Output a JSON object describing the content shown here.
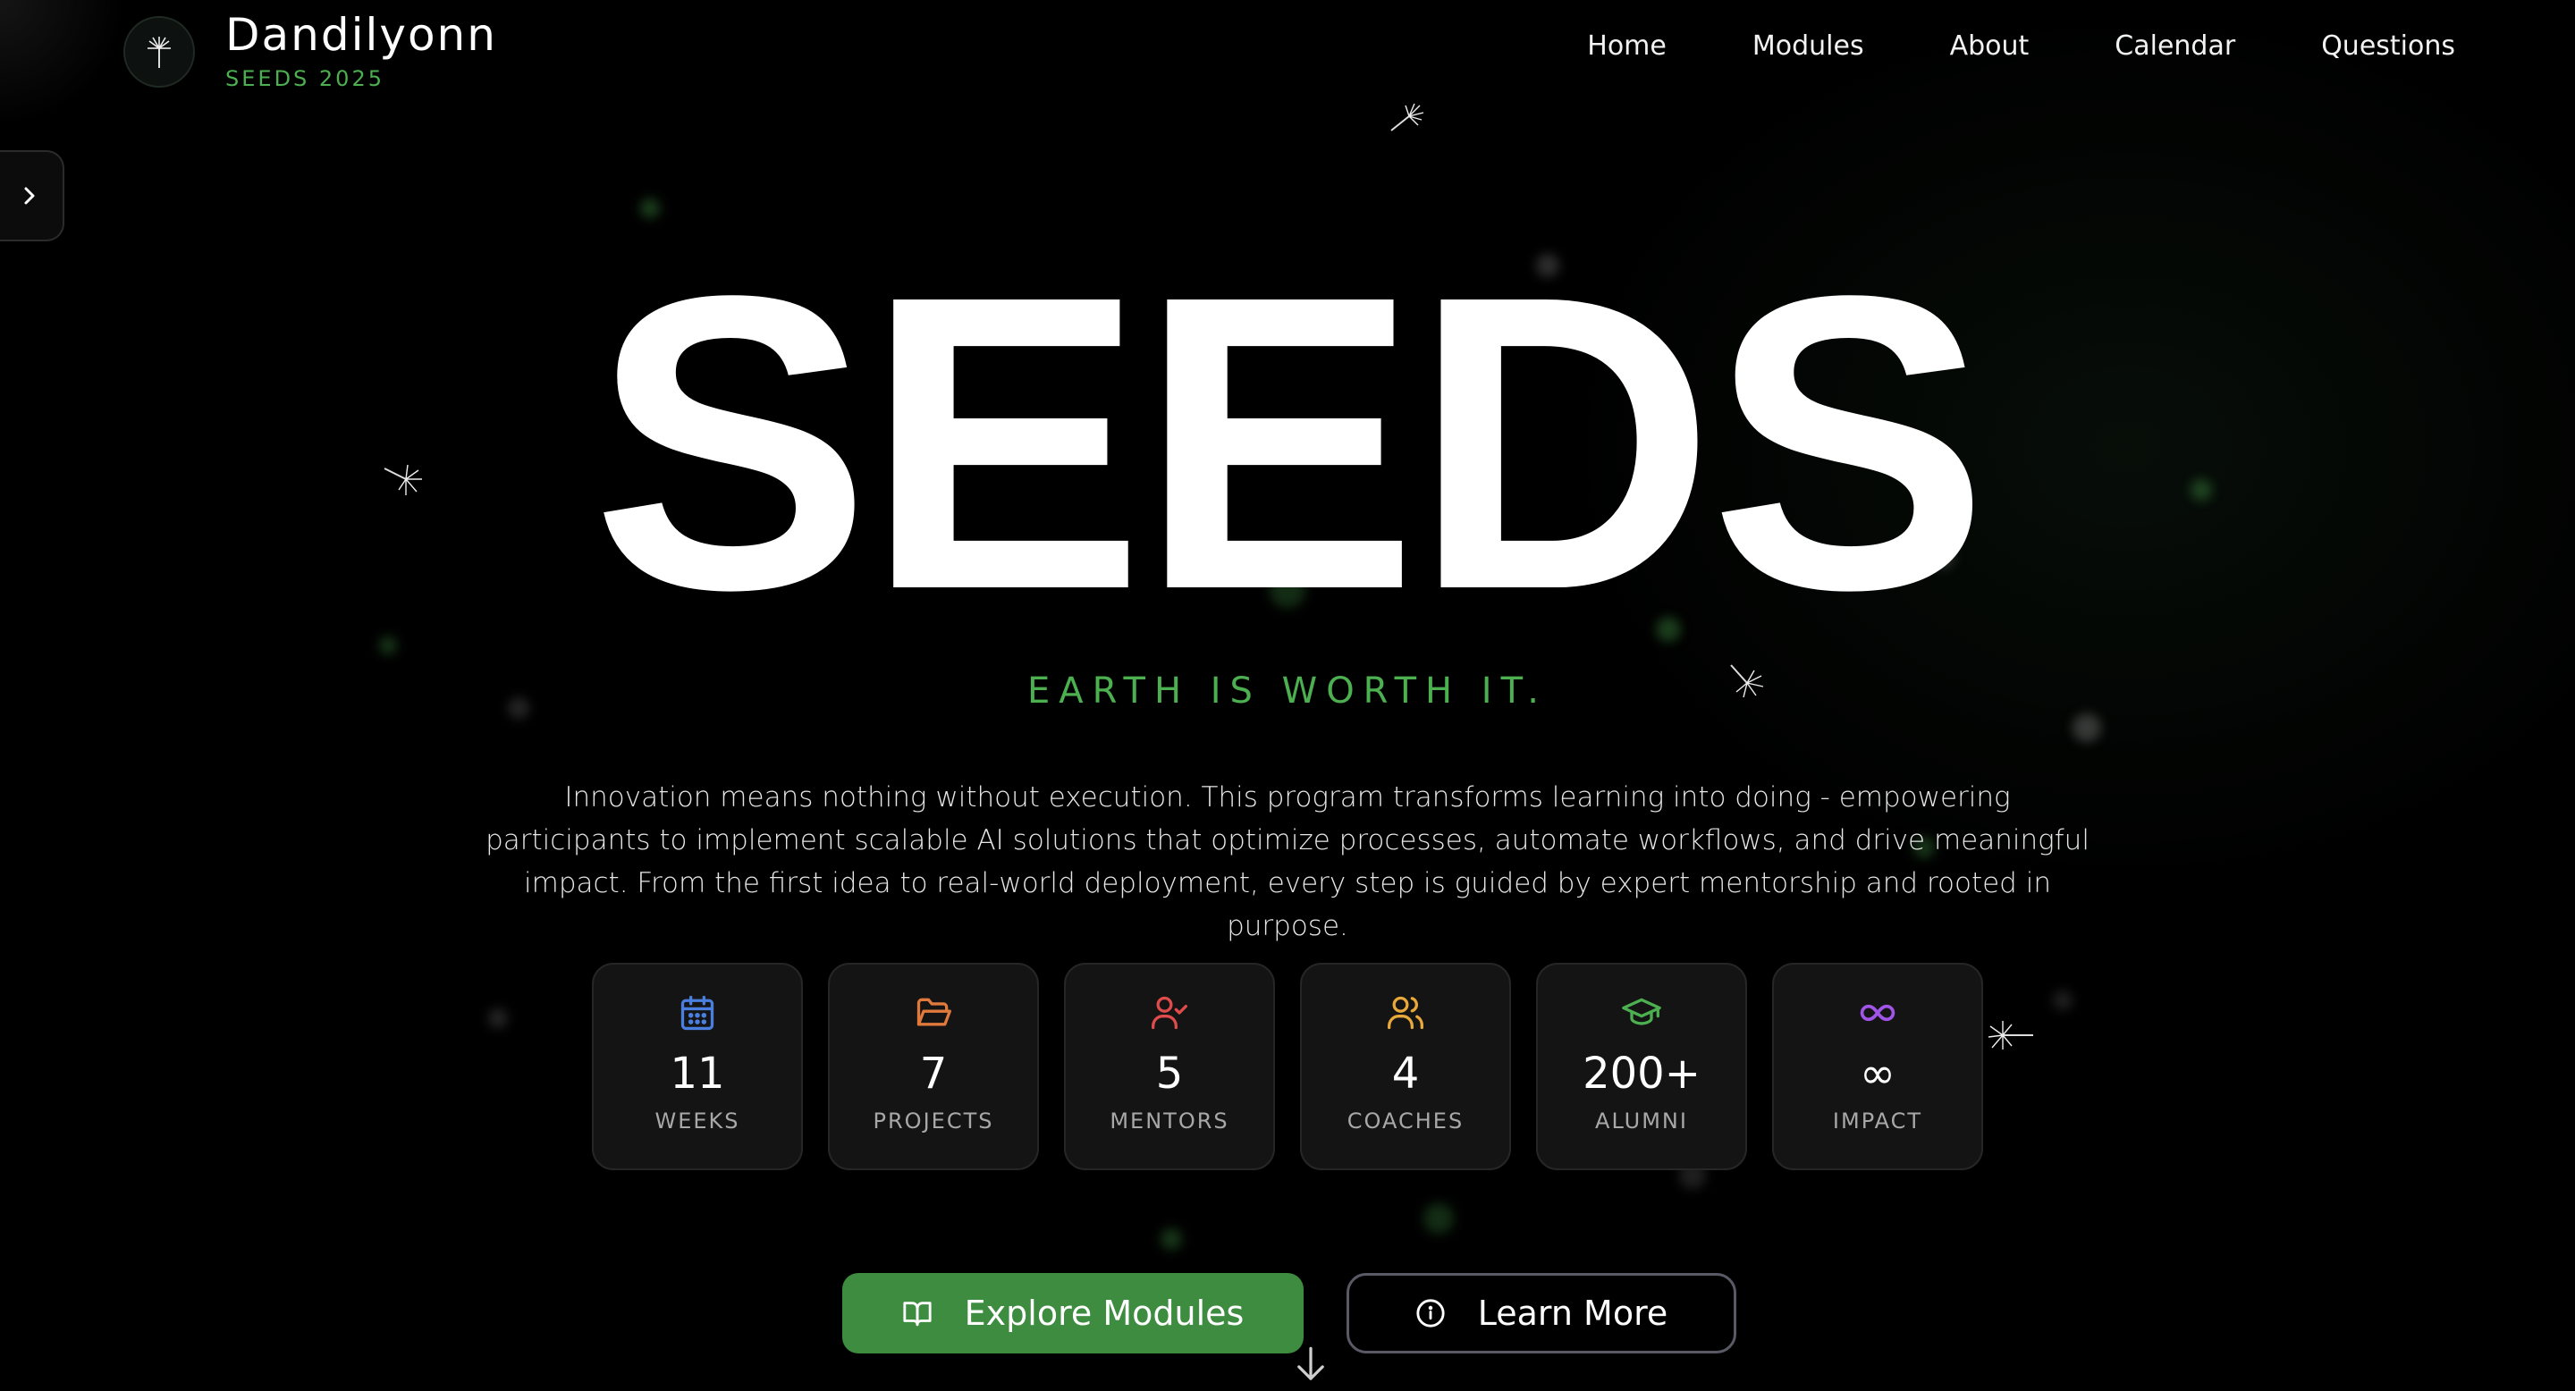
{
  "brand": {
    "name": "Dandilyonn",
    "subtitle": "SEEDS 2025",
    "logo_icon": "dandelion-icon"
  },
  "nav": {
    "items": [
      {
        "label": "Home"
      },
      {
        "label": "Modules"
      },
      {
        "label": "About"
      },
      {
        "label": "Calendar"
      },
      {
        "label": "Questions"
      }
    ]
  },
  "sidebar_toggle": {
    "icon": "chevron-right-icon"
  },
  "hero": {
    "title": "SEEDS",
    "tagline": "EARTH IS WORTH IT.",
    "intro": "Innovation means nothing without execution. This program transforms learning into doing - empowering participants to implement scalable AI solutions that optimize processes, automate workflows, and drive meaningful impact. From the first idea to real-world deployment, every step is guided by expert mentorship and rooted in purpose."
  },
  "stats": [
    {
      "value": "11",
      "label": "WEEKS",
      "icon": "calendar-icon",
      "color": "#4a7fe0"
    },
    {
      "value": "7",
      "label": "PROJECTS",
      "icon": "folder-open-icon",
      "color": "#e07a3c"
    },
    {
      "value": "5",
      "label": "MENTORS",
      "icon": "user-check-icon",
      "color": "#e04b4b"
    },
    {
      "value": "4",
      "label": "COACHES",
      "icon": "users-icon",
      "color": "#e8a93a"
    },
    {
      "value": "200+",
      "label": "ALUMNI",
      "icon": "graduation-cap-icon",
      "color": "#4caf50"
    },
    {
      "value": "∞",
      "label": "IMPACT",
      "icon": "infinity-icon",
      "color": "#a155e8"
    }
  ],
  "actions": {
    "primary_label": "Explore Modules",
    "primary_icon": "book-open-icon",
    "secondary_label": "Learn More",
    "secondary_icon": "info-icon",
    "scroll_icon": "arrow-down-icon"
  },
  "colors": {
    "background": "#000000",
    "accent_green": "#4caf50",
    "button_green": "#3d8c40",
    "card_bg": "#141414"
  }
}
